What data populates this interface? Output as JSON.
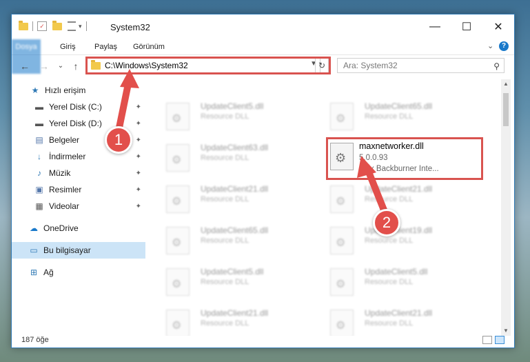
{
  "window": {
    "title": "System32",
    "controls": {
      "minimize": "—",
      "maximize": "☐",
      "close": "✕"
    }
  },
  "ribbon": {
    "tabs": [
      "Dosya",
      "Giriş",
      "Paylaş",
      "Görünüm"
    ],
    "expand_icon": "⌄",
    "help_icon": "?"
  },
  "nav": {
    "back": "←",
    "forward": "→",
    "recent": "⌄",
    "up": "↑",
    "address": "C:\\Windows\\System32",
    "refresh": "↻",
    "search_placeholder": "Ara: System32",
    "search_icon": "⚲"
  },
  "sidebar": {
    "items": [
      {
        "label": "Hızlı erişim",
        "icon": "★",
        "pinned": false
      },
      {
        "label": "Yerel Disk (C:)",
        "icon": "▬",
        "pinned": true
      },
      {
        "label": "Yerel Disk (D:)",
        "icon": "▬",
        "pinned": true
      },
      {
        "label": "Belgeler",
        "icon": "▤",
        "pinned": true
      },
      {
        "label": "İndirmeler",
        "icon": "↓",
        "pinned": true
      },
      {
        "label": "Müzik",
        "icon": "♪",
        "pinned": true
      },
      {
        "label": "Resimler",
        "icon": "▣",
        "pinned": true
      },
      {
        "label": "Videolar",
        "icon": "▦",
        "pinned": true
      },
      {
        "label": "OneDrive",
        "icon": "☁",
        "pinned": false
      },
      {
        "label": "Bu bilgisayar",
        "icon": "▭",
        "pinned": false,
        "selected": true
      },
      {
        "label": "Ağ",
        "icon": "⊞",
        "pinned": false
      }
    ],
    "pin_icon": "📌"
  },
  "files": [
    {
      "name": "UpdateClient5.dll",
      "type": "Resource DLL"
    },
    {
      "name": "UpdateClient65.dll",
      "type": "Resource DLL"
    },
    {
      "name": "UpdateClient63.dll",
      "type": "Resource DLL"
    },
    {
      "name": "UpdateClient21.dll",
      "type": "Resource DLL"
    },
    {
      "name": "UpdateClient21.dll",
      "type": "Resource DLL"
    },
    {
      "name": "UpdateClient65.dll",
      "type": "Resource DLL"
    },
    {
      "name": "UpdateClient19.dll",
      "type": "Resource DLL"
    },
    {
      "name": "UpdateClient5.dll",
      "type": "Resource DLL"
    },
    {
      "name": "UpdateClient5.dll",
      "type": "Resource DLL"
    },
    {
      "name": "UpdateClient21.dll",
      "type": "Resource DLL"
    },
    {
      "name": "UpdateClient21.dll",
      "type": "Resource DLL"
    }
  ],
  "target_file": {
    "name": "maxnetworker.dll",
    "version": "5.0.0.93",
    "company": "Max Backburner Inte..."
  },
  "status": {
    "item_count": "187 öğe"
  },
  "callouts": [
    "1",
    "2"
  ],
  "colors": {
    "accent": "#1979ca",
    "highlight": "#d9534f",
    "selection": "#cce4f7"
  }
}
